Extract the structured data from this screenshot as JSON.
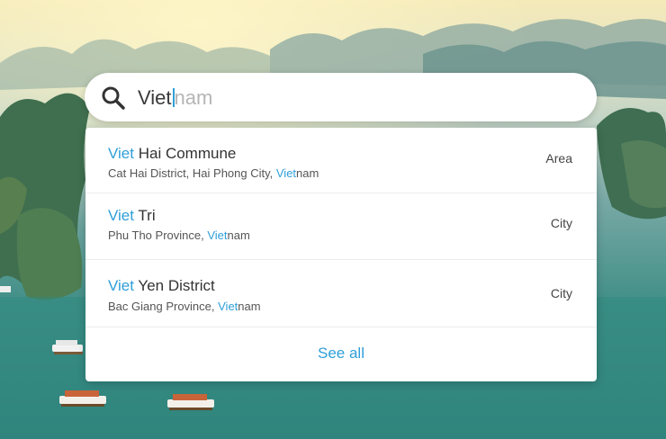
{
  "search": {
    "typed": "Viet",
    "suggestion": "nam"
  },
  "results": [
    {
      "title_highlight": "Viet",
      "title_rest": " Hai Commune",
      "sub_prefix": "Cat Hai District, Hai Phong City, ",
      "sub_highlight": "Viet",
      "sub_rest": "nam",
      "type": "Area"
    },
    {
      "title_highlight": "Viet",
      "title_rest": " Tri",
      "sub_prefix": "Phu Tho Province, ",
      "sub_highlight": "Viet",
      "sub_rest": "nam",
      "type": "City"
    },
    {
      "title_highlight": "Viet",
      "title_rest": " Yen District",
      "sub_prefix": "Bac Giang Province, ",
      "sub_highlight": "Viet",
      "sub_rest": "nam",
      "type": "City"
    }
  ],
  "see_all_label": "See all",
  "colors": {
    "accent": "#2f9fd8"
  },
  "icons": {
    "search": "search-icon"
  }
}
